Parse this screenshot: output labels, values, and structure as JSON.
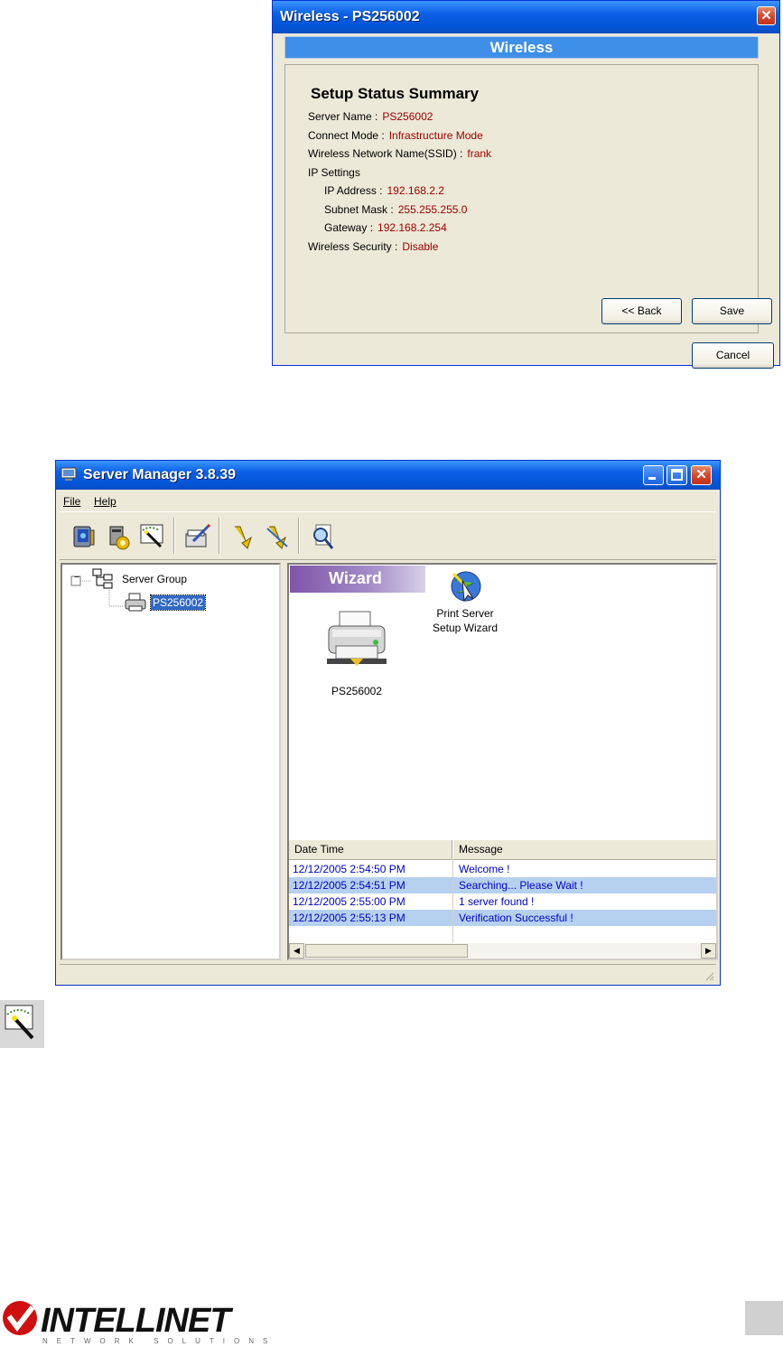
{
  "wireless_dialog": {
    "title": "Wireless - PS256002",
    "banner": "Wireless",
    "summary_title": "Setup Status Summary",
    "fields": [
      {
        "label": "Server Name :",
        "value": "PS256002"
      },
      {
        "label": "Connect Mode :",
        "value": "Infrastructure Mode"
      },
      {
        "label": "Wireless Network Name(SSID) :",
        "value": "frank"
      },
      {
        "label": "IP Settings",
        "value": ""
      },
      {
        "label": "IP Address :",
        "value": "192.168.2.2"
      },
      {
        "label": "Subnet Mask :",
        "value": "255.255.255.0"
      },
      {
        "label": "Gateway :",
        "value": "192.168.2.254"
      },
      {
        "label": "Wireless Security :",
        "value": "Disable"
      }
    ],
    "buttons": {
      "back": "<< Back",
      "save": "Save",
      "cancel": "Cancel"
    },
    "close_glyph": "✕"
  },
  "server_manager": {
    "title": "Server Manager 3.8.39",
    "menu": [
      "File",
      "Help"
    ],
    "toolbar_icons": [
      "server-properties-icon",
      "configure-icon",
      "setup-wizard-icon",
      "edit-icon",
      "connect-icon",
      "disconnect-icon",
      "search-icon"
    ],
    "tree": {
      "root": "Server Group",
      "child": "PS256002",
      "expander": "−"
    },
    "wizard_tab": "Wizard",
    "device_label": "PS256002",
    "wizard_label_line1": "Print Server",
    "wizard_label_line2": "Setup Wizard",
    "log": {
      "columns": [
        "Date Time",
        "Message"
      ],
      "rows": [
        {
          "time": "12/12/2005 2:54:50 PM",
          "message": "Welcome !"
        },
        {
          "time": "12/12/2005 2:54:51 PM",
          "message": "Searching... Please Wait !"
        },
        {
          "time": "12/12/2005 2:55:00 PM",
          "message": "1 server found !"
        },
        {
          "time": "12/12/2005 2:55:13 PM",
          "message": "Verification Successful !"
        }
      ]
    },
    "scroll_left": "◀",
    "scroll_right": "▶"
  },
  "footer": {
    "brand": "INTELLINET",
    "tagline": "NETWORK SOLUTIONS"
  }
}
